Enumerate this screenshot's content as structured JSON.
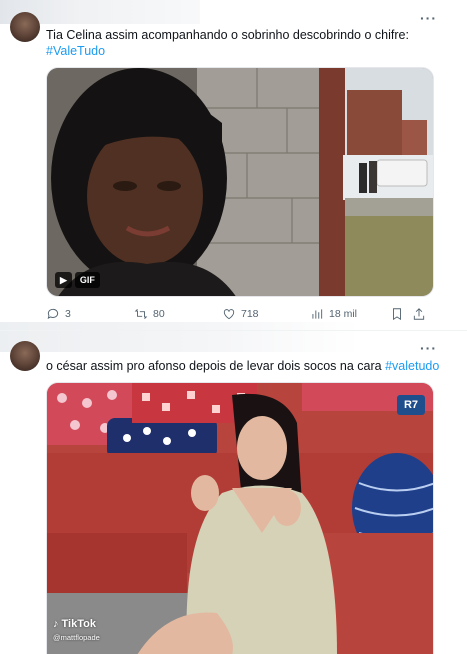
{
  "tweet1": {
    "text_plain": "Tia Celina assim acompanhando o sobrinho descobrindo o chifre:",
    "hashtag": "#ValeTudo",
    "gif_label": "GIF",
    "replies": "3",
    "retweets": "80",
    "likes": "718",
    "views": "18 mil",
    "more_icon": "more-icon"
  },
  "tweet2": {
    "text_plain": "o césar assim pro afonso depois de levar dois socos na cara",
    "hashtag": "#valetudo",
    "watermark_brand": "TikTok",
    "watermark_handle": "@mattflopade",
    "channel_logo": "R7",
    "more_icon": "more-icon"
  },
  "colors": {
    "hashtag": "#1d9bf0",
    "icon_grey": "#536471"
  }
}
